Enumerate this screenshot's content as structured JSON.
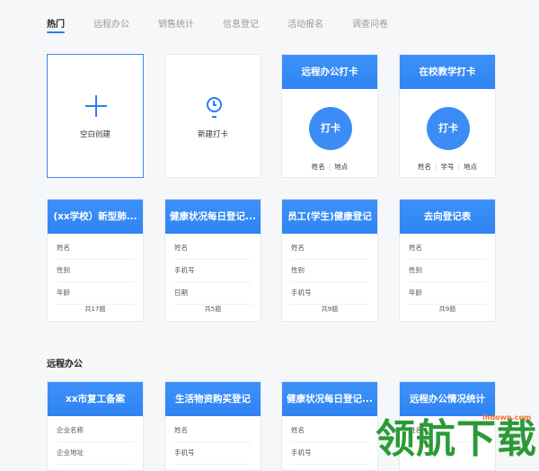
{
  "tabs": [
    "热门",
    "远程办公",
    "销售统计",
    "信息登记",
    "活动报名",
    "调查问卷"
  ],
  "row1": {
    "blank_label": "空白创建",
    "new_punch_label": "新建打卡",
    "remote_punch": {
      "title": "远程办公打卡",
      "button": "打卡",
      "fields": [
        "姓名",
        "地点"
      ]
    },
    "school_punch": {
      "title": "在校教学打卡",
      "button": "打卡",
      "fields": [
        "姓名",
        "学号",
        "地点"
      ]
    }
  },
  "row2": [
    {
      "title": "(xx学校）新型肺...",
      "fields": [
        "姓名",
        "性别",
        "年龄"
      ],
      "count": "共17题"
    },
    {
      "title": "健康状况每日登记...",
      "fields": [
        "姓名",
        "手机号",
        "日期"
      ],
      "count": "共5题"
    },
    {
      "title": "员工(学生)健康登记",
      "fields": [
        "姓名",
        "性别",
        "手机号"
      ],
      "count": "共9题"
    },
    {
      "title": "去向登记表",
      "fields": [
        "姓名",
        "性别",
        "年龄"
      ],
      "count": "共9题"
    }
  ],
  "section_remote": "远程办公",
  "row3": [
    {
      "title": "xx市复工备案",
      "fields": [
        "企业名称",
        "企业地址"
      ]
    },
    {
      "title": "生活物资购买登记",
      "fields": [
        "姓名",
        "手机号"
      ]
    },
    {
      "title": "健康状况每日登记...",
      "fields": [
        "姓名",
        "手机号"
      ]
    },
    {
      "title": "远程办公情况统计",
      "fields": [
        "姓名"
      ]
    }
  ],
  "watermark": {
    "text": "领航下载",
    "url": "lhdown.com"
  }
}
